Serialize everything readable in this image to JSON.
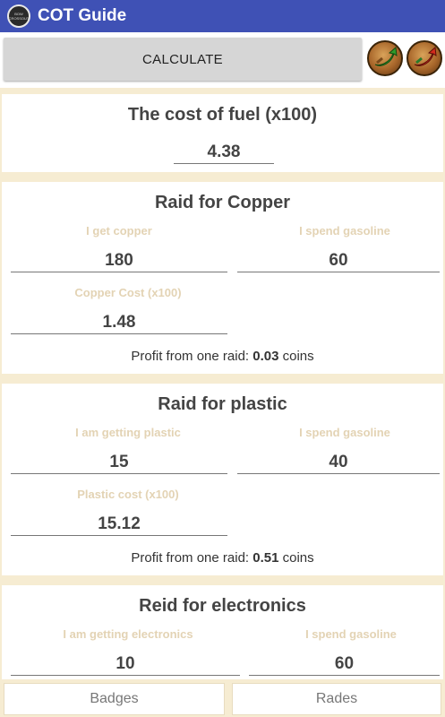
{
  "app": {
    "title": "COT Guide",
    "logo_text": "BOW CROSSOUT"
  },
  "toolbar": {
    "calculate_label": "CALCULATE"
  },
  "fuel": {
    "title": "The cost of fuel (x100)",
    "value": "4.38"
  },
  "copper": {
    "title": "Raid for Copper",
    "get_label": "I get copper",
    "get_value": "180",
    "spend_label": "I spend gasoline",
    "spend_value": "60",
    "cost_label": "Copper Cost (x100)",
    "cost_value": "1.48",
    "profit_prefix": "Profit from one raid: ",
    "profit_value": "0.03",
    "profit_suffix": " coins"
  },
  "plastic": {
    "title": "Raid for plastic",
    "get_label": "I am getting plastic",
    "get_value": "15",
    "spend_label": "I spend gasoline",
    "spend_value": "40",
    "cost_label": "Plastic cost (x100)",
    "cost_value": "15.12",
    "profit_prefix": "Profit from one raid: ",
    "profit_value": "0.51",
    "profit_suffix": " coins"
  },
  "electronics": {
    "title": "Reid for electronics",
    "get_label": "I am getting electronics",
    "get_value": "10",
    "spend_label": "I spend gasoline",
    "spend_value": "60"
  },
  "bottom_tabs": {
    "badges": "Badges",
    "rades": "Rades"
  },
  "colors": {
    "titlebar": "#3f51b5",
    "page_bg": "#f6ecd2",
    "label": "#e3d3b4"
  },
  "icons": [
    "app-logo",
    "green-arrow-icon",
    "red-arrow-icon"
  ]
}
